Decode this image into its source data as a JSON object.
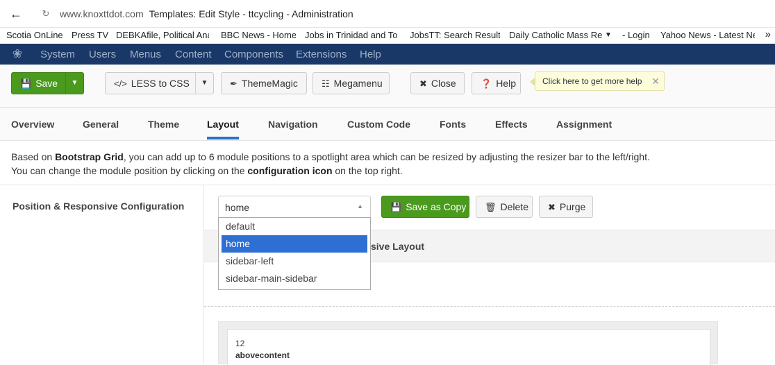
{
  "browser": {
    "host": "www.knoxttdot.com",
    "page_title": "Templates: Edit Style - ttcycling - Administration",
    "bookmarks": [
      "Scotia OnLine",
      "Press TV",
      "DEBKAfile, Political Ana",
      "BBC News - Home",
      "Jobs in Trinidad and To",
      "JobsTT: Search Results",
      "Daily Catholic Mass Rea",
      "- Login",
      "Yahoo News - Latest Ne"
    ],
    "more": "»"
  },
  "topnav": {
    "items": [
      "System",
      "Users",
      "Menus",
      "Content",
      "Components",
      "Extensions",
      "Help"
    ]
  },
  "toolbar": {
    "save": "Save",
    "less": "LESS to CSS",
    "thememagic": "ThemeMagic",
    "megamenu": "Megamenu",
    "close": "Close",
    "help": "Help",
    "tip": "Click here to get more help"
  },
  "tabs": [
    "Overview",
    "General",
    "Theme",
    "Layout",
    "Navigation",
    "Custom Code",
    "Fonts",
    "Effects",
    "Assignment"
  ],
  "active_tab": "Layout",
  "description": {
    "l1_a": "Based on ",
    "l1_b": "Bootstrap Grid",
    "l1_c": ", you can add up to 6 module positions to a spotlight area which can be resized by adjusting the resizer bar to the left/right.",
    "l2_a": "You can change the module position by clicking on the ",
    "l2_b": "configuration icon",
    "l2_c": " on the top right."
  },
  "config": {
    "label": "Position & Responsive Configuration",
    "selected": "home",
    "options": [
      "default",
      "home",
      "sidebar-left",
      "sidebar-main-sidebar"
    ],
    "save_copy": "Save as Copy",
    "delete": "Delete",
    "purge": "Purge",
    "section_title_visible": "sive Layout"
  },
  "spotlight": {
    "width": "12",
    "position": "abovecontent"
  },
  "colors": {
    "navy": "#1a3867",
    "green": "#4a9a1e",
    "blue": "#2d6fd3",
    "tab_underline": "#2c72c7"
  }
}
